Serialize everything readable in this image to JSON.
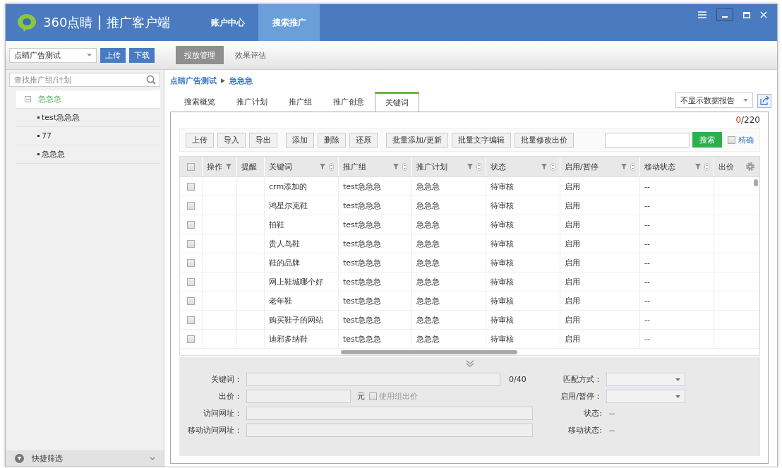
{
  "header": {
    "brand": "360点睛",
    "product": "推广客户端",
    "nav": [
      {
        "label": "账户中心",
        "selected": false
      },
      {
        "label": "搜索推广",
        "selected": true
      }
    ]
  },
  "toolbar": {
    "account": "点睛广告测试",
    "buttons": [
      "上传",
      "下载"
    ],
    "subtabs": [
      {
        "label": "投放管理",
        "selected": true
      },
      {
        "label": "效果评估",
        "selected": false
      }
    ]
  },
  "sidebar": {
    "search": {
      "placeholder": "查找推广组/计划"
    },
    "tree": [
      {
        "label": "急急急",
        "expanded": true,
        "selected": true,
        "children": [
          {
            "label": "test急急急",
            "selected": false
          },
          {
            "label": "77",
            "selected": false
          },
          {
            "label": "急急急",
            "selected": false
          }
        ]
      }
    ],
    "footer": "快捷筛选"
  },
  "breadcrumb": [
    "点睛广告测试",
    "急急急"
  ],
  "tabs": [
    {
      "label": "搜索概览",
      "selected": false
    },
    {
      "label": "推广计划",
      "selected": false
    },
    {
      "label": "推广组",
      "selected": false
    },
    {
      "label": "推广创意",
      "selected": false
    },
    {
      "label": "关键词",
      "selected": true
    }
  ],
  "report_select": "不显示数据报告",
  "counter": {
    "selected": "0",
    "total": "/220"
  },
  "actions": [
    [
      "上传",
      "导入",
      "导出"
    ],
    [
      "添加",
      "删除",
      "还原"
    ],
    [
      "批量添加/更新",
      "批量文字编辑",
      "批量修改出价"
    ]
  ],
  "search_button": "搜索",
  "exact": {
    "label": "精确",
    "checked": false
  },
  "table": {
    "select_all_checked": false,
    "columns": [
      {
        "label": "操作",
        "filter": true,
        "sort": false
      },
      {
        "label": "提醒",
        "filter": false,
        "sort": false
      },
      {
        "label": "关键词",
        "filter": true,
        "sort": true
      },
      {
        "label": "推广组",
        "filter": true,
        "sort": true
      },
      {
        "label": "推广计划",
        "filter": true,
        "sort": true
      },
      {
        "label": "状态",
        "filter": true,
        "sort": true
      },
      {
        "label": "启用/暂停",
        "filter": true,
        "sort": true
      },
      {
        "label": "移动状态",
        "filter": true,
        "sort": true
      },
      {
        "label": "出价",
        "filter": false,
        "sort": false
      }
    ],
    "rows": [
      {
        "checked": false,
        "keyword": "crm添加的",
        "group": "test急急急",
        "plan": "急急急",
        "status": "待审核",
        "enabled": "启用",
        "mobile_status": "--"
      },
      {
        "checked": false,
        "keyword": "鸿星尔克鞋",
        "group": "test急急急",
        "plan": "急急急",
        "status": "待审核",
        "enabled": "启用",
        "mobile_status": "--"
      },
      {
        "checked": false,
        "keyword": "拍鞋",
        "group": "test急急急",
        "plan": "急急急",
        "status": "待审核",
        "enabled": "启用",
        "mobile_status": "--"
      },
      {
        "checked": false,
        "keyword": "贵人鸟鞋",
        "group": "test急急急",
        "plan": "急急急",
        "status": "待审核",
        "enabled": "启用",
        "mobile_status": "--"
      },
      {
        "checked": false,
        "keyword": "鞋的品牌",
        "group": "test急急急",
        "plan": "急急急",
        "status": "待审核",
        "enabled": "启用",
        "mobile_status": "--"
      },
      {
        "checked": false,
        "keyword": "网上鞋城哪个好",
        "group": "test急急急",
        "plan": "急急急",
        "status": "待审核",
        "enabled": "启用",
        "mobile_status": "--"
      },
      {
        "checked": false,
        "keyword": "老年鞋",
        "group": "test急急急",
        "plan": "急急急",
        "status": "待审核",
        "enabled": "启用",
        "mobile_status": "--"
      },
      {
        "checked": false,
        "keyword": "购买鞋子的网站",
        "group": "test急急急",
        "plan": "急急急",
        "status": "待审核",
        "enabled": "启用",
        "mobile_status": "--"
      },
      {
        "checked": false,
        "keyword": "迪邪多纳鞋",
        "group": "test急急急",
        "plan": "急急急",
        "status": "待审核",
        "enabled": "启用",
        "mobile_status": "--"
      }
    ]
  },
  "form": {
    "keyword": {
      "label": "关键词：",
      "counter": "0/40"
    },
    "bid": {
      "label": "出价：",
      "unit": "元",
      "use_group": {
        "label": "使用组出价",
        "checked": false
      }
    },
    "url": {
      "label": "访问网址："
    },
    "mobile_url": {
      "label": "移动访问网址："
    },
    "match": {
      "label": "匹配方式："
    },
    "toggle": {
      "label": "启用/暂停："
    },
    "status": {
      "label": "状态:",
      "value": "--"
    },
    "mobile_status": {
      "label": "移动状态:",
      "value": "--"
    }
  }
}
